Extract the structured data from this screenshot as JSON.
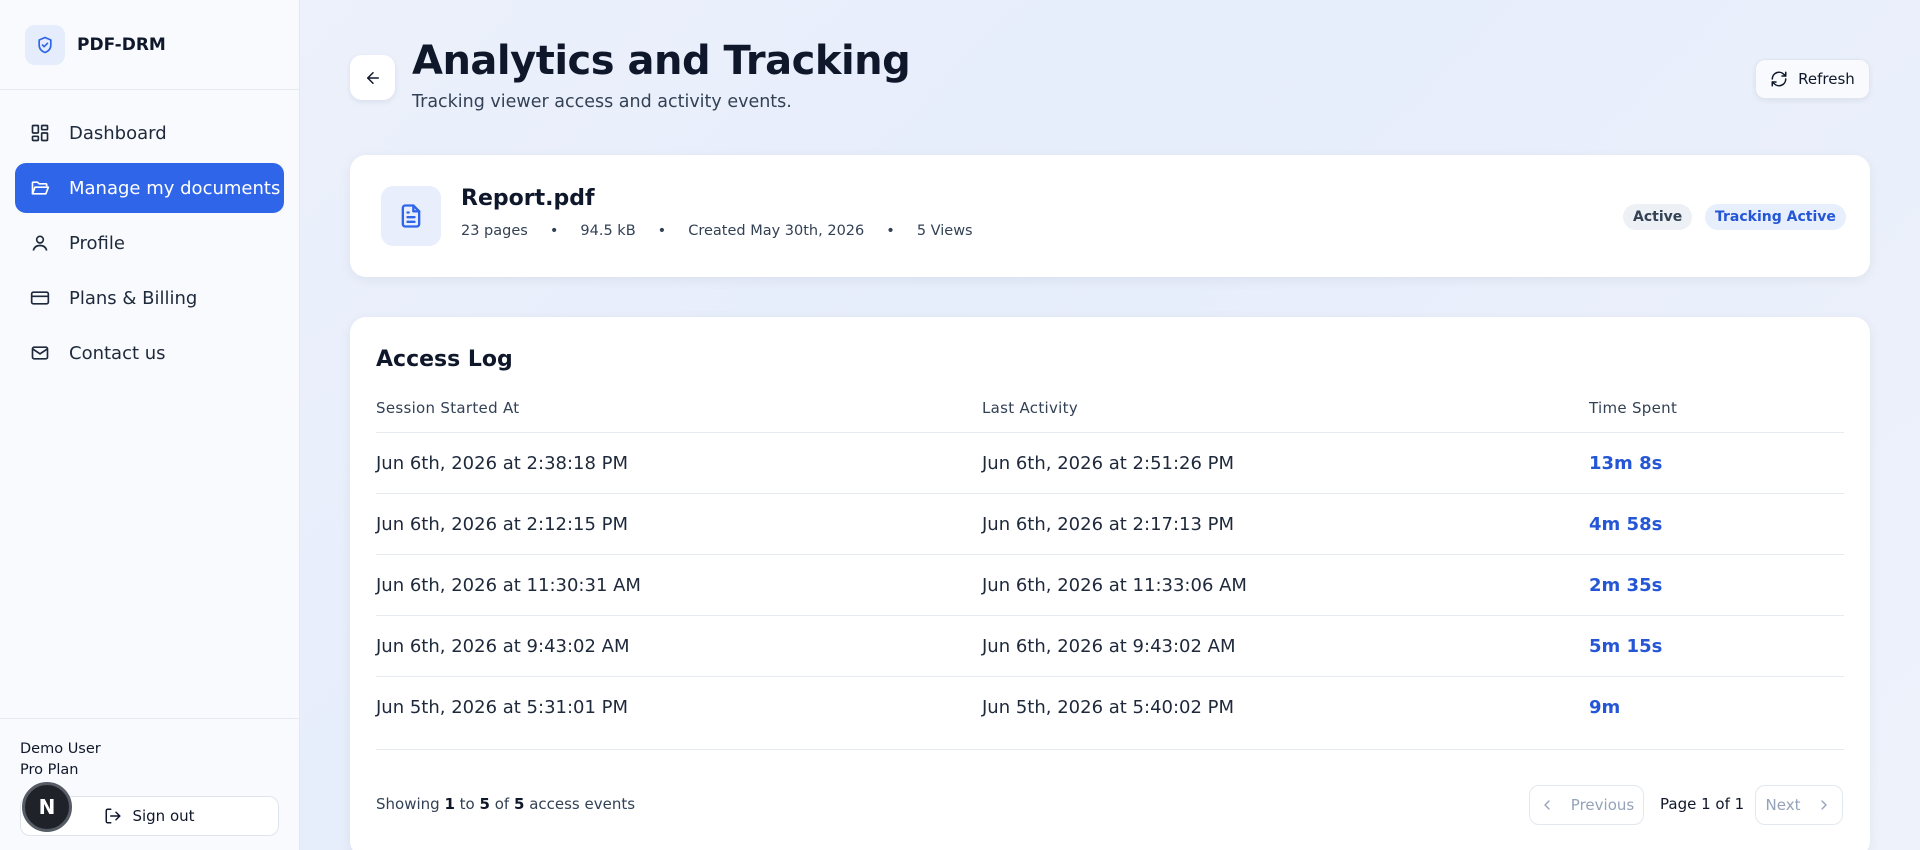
{
  "brand": {
    "name": "PDF-DRM",
    "logo_icon": "shield-check-icon"
  },
  "sidebar": {
    "items": [
      {
        "label": "Dashboard",
        "icon": "dashboard-grid-icon",
        "active": false
      },
      {
        "label": "Manage my documents",
        "icon": "folder-open-icon",
        "active": true
      },
      {
        "label": "Profile",
        "icon": "user-icon",
        "active": false
      },
      {
        "label": "Plans & Billing",
        "icon": "credit-card-icon",
        "active": false
      },
      {
        "label": "Contact us",
        "icon": "mail-icon",
        "active": false
      }
    ],
    "user": {
      "name": "Demo User",
      "plan": "Pro Plan",
      "avatar_letter": "N"
    },
    "signout_label": "Sign out"
  },
  "header": {
    "title": "Analytics and Tracking",
    "subtitle": "Tracking viewer access and activity events.",
    "refresh_label": "Refresh"
  },
  "document": {
    "name": "Report.pdf",
    "pages": "23 pages",
    "size": "94.5 kB",
    "created": "Created May 30th, 2026",
    "views": "5 Views",
    "separator": "•",
    "badges": {
      "status": "Active",
      "tracking": "Tracking Active"
    }
  },
  "access_log": {
    "title": "Access Log",
    "columns": [
      "Session Started At",
      "Last Activity",
      "Time Spent"
    ],
    "rows": [
      {
        "started": "Jun 6th, 2026 at 2:38:18 PM",
        "last": "Jun 6th, 2026 at 2:51:26 PM",
        "spent": "13m 8s"
      },
      {
        "started": "Jun 6th, 2026 at 2:12:15 PM",
        "last": "Jun 6th, 2026 at 2:17:13 PM",
        "spent": "4m 58s"
      },
      {
        "started": "Jun 6th, 2026 at 11:30:31 AM",
        "last": "Jun 6th, 2026 at 11:33:06 AM",
        "spent": "2m 35s"
      },
      {
        "started": "Jun 6th, 2026 at 9:43:02 AM",
        "last": "Jun 6th, 2026 at 9:43:02 AM",
        "spent": "5m 15s"
      },
      {
        "started": "Jun 5th, 2026 at 5:31:01 PM",
        "last": "Jun 5th, 2026 at 5:40:02 PM",
        "spent": "9m"
      }
    ],
    "footer": {
      "prefix": "Showing",
      "from": "1",
      "to_word": "to",
      "to": "5",
      "of_word": "of",
      "total": "5",
      "suffix": "access events"
    },
    "pagination": {
      "previous": "Previous",
      "page_label": "Page 1 of 1",
      "next": "Next"
    }
  },
  "colors": {
    "accent": "#2f65e8",
    "link_blue": "#2456d6"
  }
}
